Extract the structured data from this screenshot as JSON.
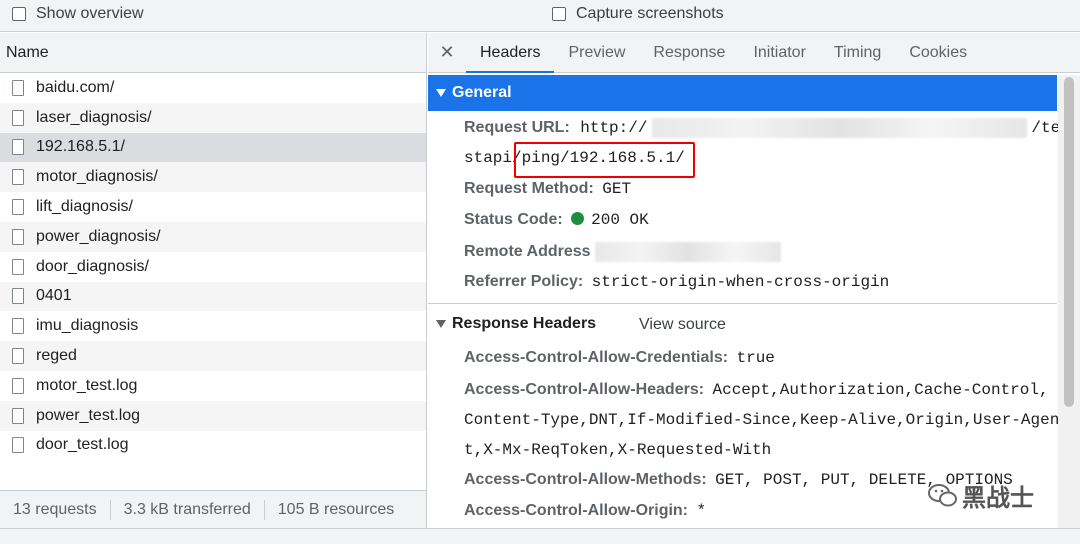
{
  "options": {
    "show_overview": "Show overview",
    "capture_screenshots": "Capture screenshots"
  },
  "requests": {
    "header": "Name",
    "items": [
      {
        "name": "baidu.com/"
      },
      {
        "name": "laser_diagnosis/"
      },
      {
        "name": "192.168.5.1/"
      },
      {
        "name": "motor_diagnosis/"
      },
      {
        "name": "lift_diagnosis/"
      },
      {
        "name": "power_diagnosis/"
      },
      {
        "name": "door_diagnosis/"
      },
      {
        "name": "0401"
      },
      {
        "name": "imu_diagnosis"
      },
      {
        "name": "reged"
      },
      {
        "name": "motor_test.log"
      },
      {
        "name": "power_test.log"
      },
      {
        "name": "door_test.log"
      }
    ],
    "selected_index": 2
  },
  "status": {
    "requests": "13 requests",
    "transferred": "3.3 kB transferred",
    "resources": "105 B resources"
  },
  "tabs": [
    "Headers",
    "Preview",
    "Response",
    "Initiator",
    "Timing",
    "Cookies"
  ],
  "active_tab": "Headers",
  "general": {
    "title": "General",
    "request_url_label": "Request URL:",
    "request_url_start": "http://",
    "request_url_end": "/te",
    "request_url_line2_prefix": "stapi/",
    "request_url_line2_highlight": "ping/192.168.5.1/",
    "request_method_label": "Request Method:",
    "request_method": "GET",
    "status_code_label": "Status Code:",
    "status_code": "200 OK",
    "remote_address_label": "Remote Address",
    "referrer_policy_label": "Referrer Policy:",
    "referrer_policy": "strict-origin-when-cross-origin"
  },
  "response_headers": {
    "title": "Response Headers",
    "view_source": "View source",
    "acac_label": "Access-Control-Allow-Credentials:",
    "acac_value": "true",
    "acah_label": "Access-Control-Allow-Headers:",
    "acah_value_1": "Accept,Authorization,Cache-Control,",
    "acah_value_2": "Content-Type,DNT,If-Modified-Since,Keep-Alive,Origin,User-Agen",
    "acah_value_3": "t,X-Mx-ReqToken,X-Requested-With",
    "acam_label": "Access-Control-Allow-Methods:",
    "acam_value": "GET, POST, PUT, DELETE, OPTIONS",
    "acao_label": "Access-Control-Allow-Origin:",
    "acao_value": "*"
  },
  "watermark": "黑战士",
  "colors": {
    "accent": "#1a73e8",
    "status_ok": "#1e8e3e",
    "highlight_box": "#e00000"
  }
}
